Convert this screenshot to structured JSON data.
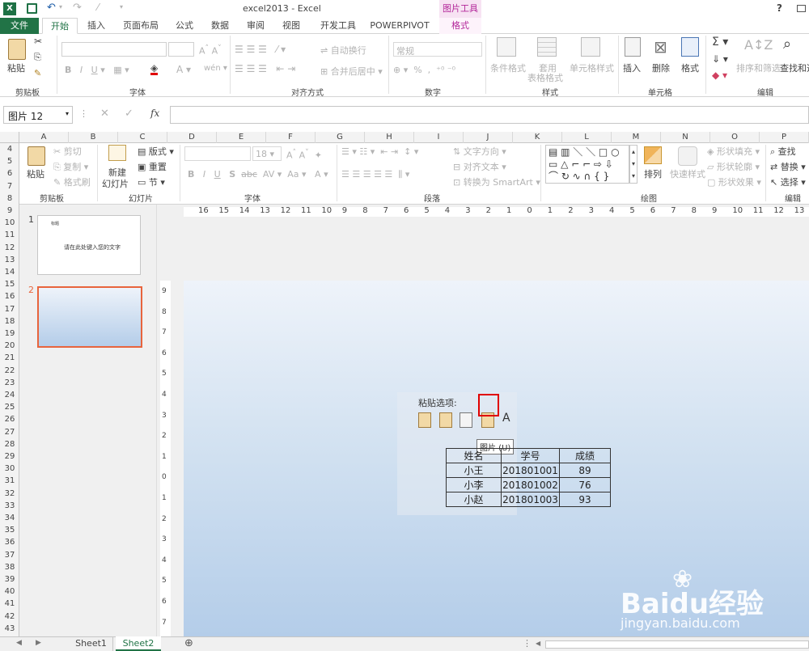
{
  "window": {
    "title": "excel2013 - Excel",
    "help": "?",
    "context_group": "图片工具"
  },
  "ribbon_tabs": [
    "文件",
    "开始",
    "插入",
    "页面布局",
    "公式",
    "数据",
    "审阅",
    "视图",
    "开发工具",
    "POWERPIVOT",
    "格式"
  ],
  "ribbon1": {
    "clipboard": {
      "paste": "粘贴",
      "label": "剪贴板"
    },
    "font": {
      "label": "字体"
    },
    "alignment": {
      "wrap": "自动换行",
      "merge": "合并后居中",
      "label": "对齐方式"
    },
    "number": {
      "format": "常规",
      "label": "数字"
    },
    "styles": {
      "cond": "条件格式",
      "table": "套用",
      "table2": "表格格式",
      "cell": "单元格样式",
      "label": "样式"
    },
    "cells": {
      "insert": "插入",
      "delete": "删除",
      "format": "格式",
      "label": "单元格"
    },
    "editing": {
      "sort": "排序和筛选",
      "find": "查找和选",
      "label": "编辑"
    }
  },
  "formula_bar": {
    "name_box": "图片 12",
    "fx": "fx",
    "formula": ""
  },
  "columns": [
    "A",
    "B",
    "C",
    "D",
    "E",
    "F",
    "G",
    "H",
    "I",
    "J",
    "K",
    "L",
    "M",
    "N",
    "O",
    "P"
  ],
  "rows": [
    "4",
    "5",
    "6",
    "7",
    "8",
    "9",
    "10",
    "11",
    "12",
    "13",
    "14",
    "15",
    "16",
    "17",
    "18",
    "19",
    "20",
    "21",
    "22",
    "23",
    "24",
    "25",
    "26",
    "27",
    "28",
    "29",
    "30",
    "31",
    "32",
    "33",
    "34",
    "35",
    "36",
    "37",
    "38",
    "39",
    "40",
    "41",
    "42",
    "43"
  ],
  "ribbon2": {
    "clipboard": {
      "cut": "剪切",
      "copy": "复制",
      "painter": "格式刷",
      "paste": "粘贴",
      "label": "剪贴板"
    },
    "slides": {
      "new1": "新建",
      "new2": "幻灯片",
      "layout": "版式",
      "reset": "重置",
      "section": "节",
      "label": "幻灯片"
    },
    "font": {
      "size": "18",
      "label": "字体"
    },
    "paragraph": {
      "direction": "文字方向",
      "align": "对齐文本",
      "smartart": "转换为 SmartArt",
      "label": "段落"
    },
    "drawing": {
      "arrange": "排列",
      "quick": "快速样式",
      "fill": "形状填充",
      "outline": "形状轮廓",
      "effect": "形状效果",
      "label": "绘图"
    },
    "editing": {
      "find": "查找",
      "replace": "替换",
      "select": "选择",
      "label": "编辑"
    }
  },
  "ruler": {
    "h": [
      "16",
      "15",
      "14",
      "13",
      "12",
      "11",
      "10",
      "9",
      "8",
      "7",
      "6",
      "5",
      "4",
      "3",
      "2",
      "1",
      "0",
      "1",
      "2",
      "3",
      "4",
      "5",
      "6",
      "7",
      "8",
      "9",
      "10",
      "11",
      "12",
      "13"
    ],
    "v": [
      "9",
      "8",
      "7",
      "6",
      "5",
      "4",
      "3",
      "2",
      "1",
      "0",
      "1",
      "2",
      "3",
      "4",
      "5",
      "6",
      "7"
    ]
  },
  "slide_panel": {
    "slide1_num": "1",
    "slide1_text": "请在此处键入您的文字",
    "slide1_title": "标题",
    "slide2_num": "2"
  },
  "paste_options": {
    "title": "粘贴选项:",
    "tooltip": "图片 (U)"
  },
  "table": {
    "headers": [
      "姓名",
      "学号",
      "成绩"
    ],
    "rows": [
      [
        "小王",
        "201801001",
        "89"
      ],
      [
        "小李",
        "201801002",
        "76"
      ],
      [
        "小赵",
        "201801003",
        "93"
      ]
    ]
  },
  "sheet_tabs": [
    "Sheet1",
    "Sheet2"
  ],
  "watermark": {
    "brand": "Baidu经验",
    "url": "jingyan.baidu.com"
  }
}
